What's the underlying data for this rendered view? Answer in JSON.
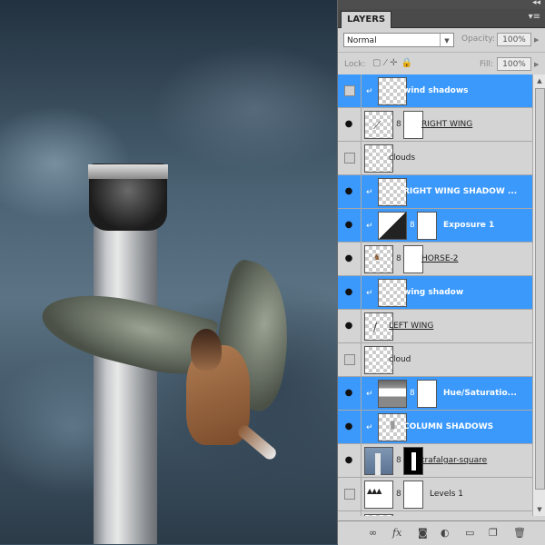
{
  "panel": {
    "tab_label": "LAYERS",
    "blend_mode": "Normal",
    "opacity_label": "Opacity:",
    "opacity_value": "100%",
    "lock_label": "Lock:",
    "fill_label": "Fill:",
    "fill_value": "100%"
  },
  "layers": [
    {
      "name": "wind shadows",
      "visible": false,
      "selected": true,
      "clipped": true
    },
    {
      "name": "RIGHT WING",
      "visible": true,
      "selected": false,
      "clipped": false
    },
    {
      "name": "clouds",
      "visible": false,
      "selected": false,
      "clipped": false
    },
    {
      "name": "RIGHT WING SHADOW ...",
      "visible": true,
      "selected": true,
      "clipped": true
    },
    {
      "name": "Exposure 1",
      "visible": true,
      "selected": true,
      "clipped": true
    },
    {
      "name": "HORSE-2",
      "visible": true,
      "selected": false,
      "clipped": false
    },
    {
      "name": "wing shadow",
      "visible": true,
      "selected": true,
      "clipped": true
    },
    {
      "name": "LEFT WING",
      "visible": true,
      "selected": false,
      "clipped": false
    },
    {
      "name": "cloud",
      "visible": false,
      "selected": false,
      "clipped": false
    },
    {
      "name": "Hue/Saturatio...",
      "visible": true,
      "selected": true,
      "clipped": true
    },
    {
      "name": "COLUMN SHADOWS",
      "visible": true,
      "selected": true,
      "clipped": true
    },
    {
      "name": "trafalgar-square",
      "visible": true,
      "selected": false,
      "clipped": false
    },
    {
      "name": "Levels 1",
      "visible": false,
      "selected": false,
      "clipped": false
    }
  ],
  "icons": {
    "panel_menu": "panel-menu-icon",
    "link": "link-layers-icon",
    "fx": "fx-icon",
    "mask": "add-mask-icon",
    "adjustment": "new-adjustment-icon",
    "group": "new-group-icon",
    "new_layer": "new-layer-icon",
    "trash": "trash-icon"
  }
}
